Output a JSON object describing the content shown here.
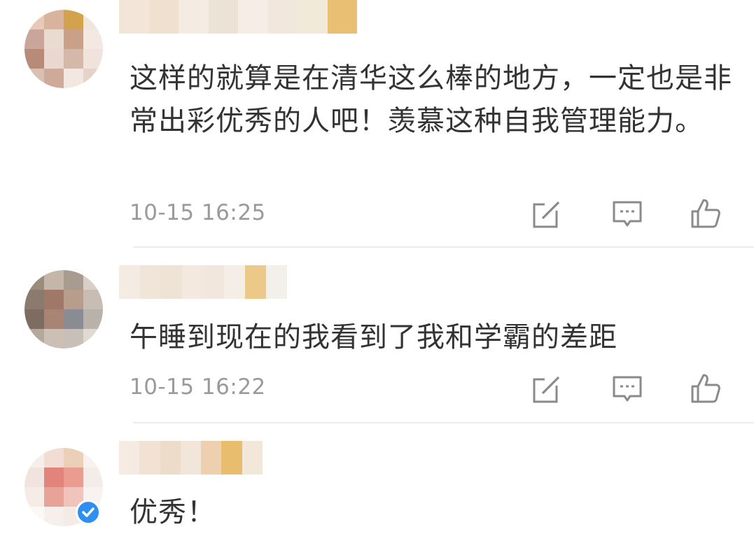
{
  "comments": [
    {
      "text": "这样的就算是在清华这么棒的地方，一定也是非常出彩优秀的人吧！羡慕这种自我管理能力。",
      "time": "10-15 16:25",
      "avatar_colors": [
        "#e8c9b8",
        "#d9b49c",
        "#d4a24c",
        "#f1e6dc",
        "#caa69a",
        "#eadbd1",
        "#c9a088",
        "#f3e9e2",
        "#b88a78",
        "#e9d8cf",
        "#d6b8a8",
        "#efe3dc",
        "#d8c0b4",
        "#cfa99a",
        "#f2e7e1",
        "#e5d2c8"
      ],
      "username_colors": [
        "#f3e6d9",
        "#f0e0d0",
        "#f4ebe2",
        "#ede2d6",
        "#f6eee6",
        "#f1e7dc",
        "#f2ead8",
        "#e8bf73"
      ]
    },
    {
      "text": "午睡到现在的我看到了我和学霸的差距",
      "time": "10-15 16:22",
      "avatar_colors": [
        "#9b8c7c",
        "#c4b6a8",
        "#a89c90",
        "#d8cfc6",
        "#8c7a6e",
        "#a07868",
        "#b89c8c",
        "#c8bdb2",
        "#7e6c60",
        "#a88474",
        "#8a8c94",
        "#b9b2ab",
        "#b7a89c",
        "#cdbfb3",
        "#c8c0b8",
        "#e1dad3"
      ],
      "username_colors": [
        "#f4ebe3",
        "#f1e4d8",
        "#efe3d6",
        "#f3e9df",
        "#f2e7dc",
        "#f5eee7",
        "#ecc989",
        "#f3efe9"
      ]
    },
    {
      "text": "优秀！",
      "time": "",
      "avatar_colors": [
        "#f6eeea",
        "#f2dcd4",
        "#ebcfb6",
        "#f7f2ee",
        "#f1e4de",
        "#e3847c",
        "#ea9c90",
        "#f4ece8",
        "#f5ebe7",
        "#e7a398",
        "#f0c3bb",
        "#f8f3f1",
        "#fbf8f6",
        "#f7efec",
        "#f4ebe7",
        "#fbf8f7"
      ],
      "username_colors": [
        "#f5ebe2",
        "#f1e2d4",
        "#eedcca",
        "#f2e6da",
        "#eed0b0",
        "#e8bd6e",
        "#f2e7d8"
      ]
    }
  ],
  "icons": {
    "repost": "share-edit-icon",
    "reply": "comment-bubble-icon",
    "like": "thumbs-up-icon",
    "badge": "verified-check-icon"
  },
  "colors": {
    "text": "#333333",
    "time": "#9a9a9a",
    "icon": "#8a8a8a",
    "divider": "#ececec",
    "verified": "#2f8ff0"
  }
}
